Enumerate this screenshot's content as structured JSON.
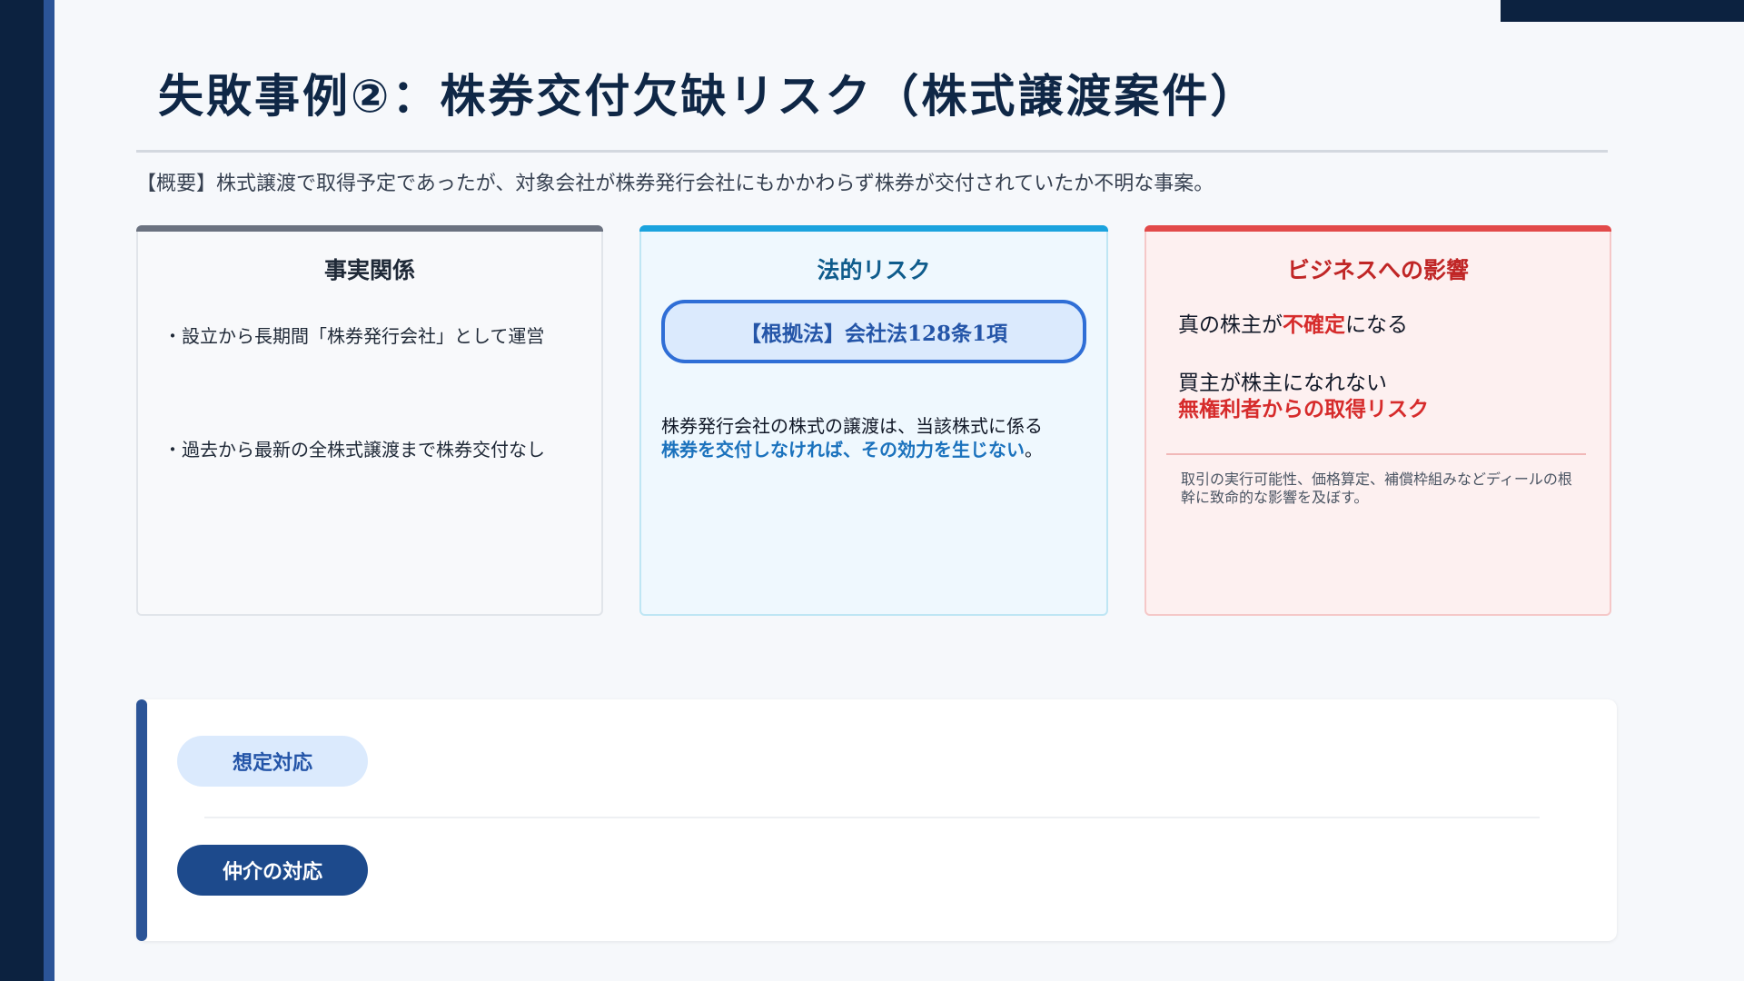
{
  "title": "失敗事例②：株券交付欠缺リスク（株式譲渡案件）",
  "summary": "【概要】株式譲渡で取得予定であったが、対象会社が株券発行会社にもかかわらず株券が交付されていたか不明な事案。",
  "facts": {
    "heading": "事実関係",
    "items": [
      "・設立から長期間「株券発行会社」として運営",
      "・過去から最新の全株式譲渡まで株券交付なし"
    ]
  },
  "legal": {
    "heading": "法的リスク",
    "law_ref": "【根拠法】会社法128条1項",
    "text_plain": "株券発行会社の株式の譲渡は、当該株式に係る",
    "text_emphasis": "株券を交付しなければ、その効力を生じない",
    "text_end": "。"
  },
  "business": {
    "heading": "ビジネスへの影響",
    "line1_prefix": "真の株主が",
    "line1_emphasis": "不確定",
    "line1_suffix": "になる",
    "line2": "買主が株主になれない",
    "line3": "無権利者からの取得リスク",
    "note": "取引の実行可能性、価格算定、補償枠組みなどディールの根幹に致命的な影響を及ぼす。"
  },
  "response": {
    "expected_label": "想定対応",
    "broker_label": "仲介の対応"
  },
  "colors": {
    "navy": "#0c2240",
    "accent_blue": "#2b5497",
    "legal_blue": "#1ba3de",
    "risk_red": "#e24a4a"
  }
}
